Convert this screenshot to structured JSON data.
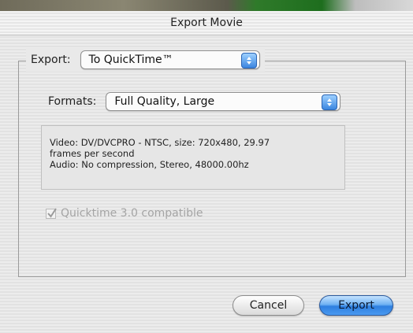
{
  "window": {
    "title": "Export Movie"
  },
  "export": {
    "label": "Export:",
    "selected": "To QuickTime™"
  },
  "formats": {
    "label": "Formats:",
    "selected": "Full Quality, Large"
  },
  "info": {
    "video_line1": "Video: DV/DVCPRO - NTSC, size: 720x480, 29.97",
    "video_line2": "frames per second",
    "audio_line": "Audio: No compression, Stereo, 48000.00hz"
  },
  "compat_checkbox": {
    "label": "Quicktime 3.0 compatible",
    "checked": true,
    "enabled": false
  },
  "buttons": {
    "cancel": "Cancel",
    "export": "Export"
  },
  "colors": {
    "default_button": "#4a9af0",
    "popup_arrows": "#3b86e0",
    "disabled_text": "#a4a4a4"
  }
}
